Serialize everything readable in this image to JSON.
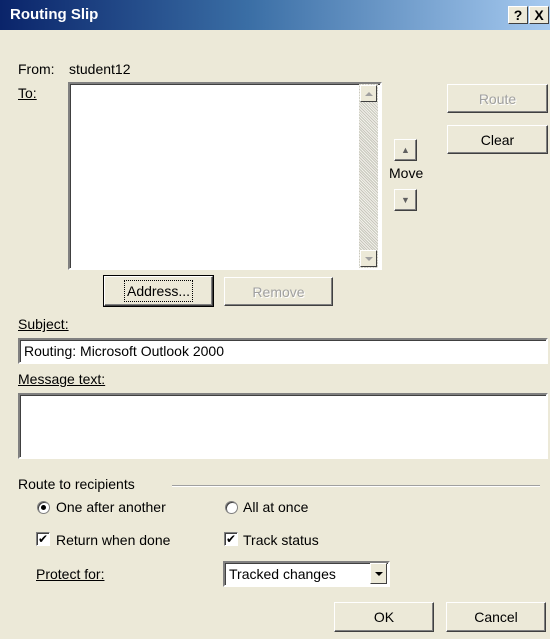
{
  "window": {
    "title": "Routing Slip",
    "help_glyph": "?",
    "close_glyph": "X"
  },
  "from": {
    "label": "From:",
    "value": "student12"
  },
  "to": {
    "label": "To:",
    "recipients": []
  },
  "buttons": {
    "route": "Route",
    "clear": "Clear",
    "address": "Address...",
    "remove": "Remove",
    "ok": "OK",
    "cancel": "Cancel"
  },
  "move": {
    "label": "Move",
    "up_glyph": "▲",
    "down_glyph": "▼"
  },
  "subject": {
    "label": "Subject:",
    "value": "Routing: Microsoft Outlook 2000"
  },
  "message": {
    "label": "Message text:",
    "value": ""
  },
  "route_group": {
    "label": "Route to recipients",
    "one_after_another": "One after another",
    "all_at_once": "All at once",
    "selected": "one_after_another",
    "return_when_done": "Return when done",
    "return_when_done_checked": true,
    "track_status": "Track status",
    "track_status_checked": true,
    "check_glyph": "✔"
  },
  "protect": {
    "label": "Protect for:",
    "value": "Tracked changes"
  },
  "colors": {
    "face": "#ece9d8",
    "title_start": "#0a246a",
    "title_end": "#a6caf0",
    "disabled_text": "#a0a0a0"
  },
  "icons": [
    "help-icon",
    "close-icon",
    "scroll-up-icon",
    "scroll-down-icon",
    "move-up-icon",
    "move-down-icon",
    "radio-selected-icon",
    "checkmark-icon",
    "dropdown-arrow-icon"
  ]
}
